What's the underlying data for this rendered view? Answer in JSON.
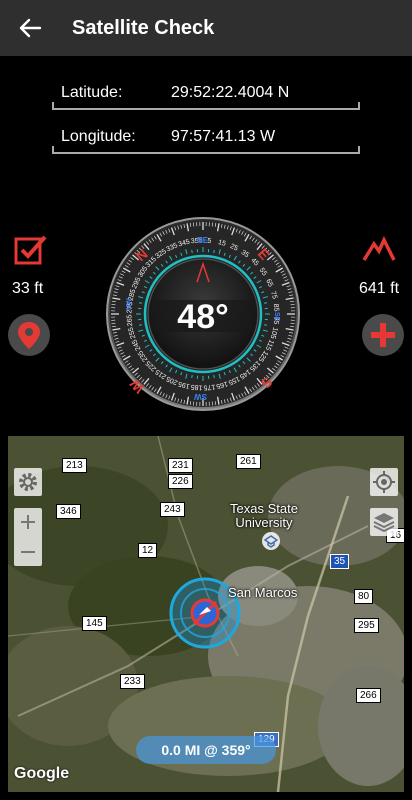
{
  "appbar": {
    "title": "Satellite Check"
  },
  "coords": {
    "latitude_label": "Latitude:",
    "latitude_value": "29:52:22.4004 N",
    "longitude_label": "Longitude:",
    "longitude_value": "97:57:41.13 W"
  },
  "left_panel": {
    "accuracy": "33 ft"
  },
  "right_panel": {
    "altitude": "641 ft"
  },
  "compass": {
    "heading": "48°",
    "cardinals": {
      "n": "N",
      "e": "E",
      "s": "S",
      "w": "W"
    },
    "inner": {
      "ne": "NE",
      "se": "SE",
      "sw": "SW",
      "nw": "NW"
    }
  },
  "map": {
    "status": "0.0 MI @ 359°",
    "provider": "Google",
    "places": {
      "university": "Texas State\nUniversity",
      "city": "San Marcos"
    },
    "shields": [
      "213",
      "231",
      "261",
      "226",
      "346",
      "243",
      "12",
      "145",
      "233",
      "35",
      "80",
      "295",
      "266",
      "16",
      "129"
    ]
  },
  "colors": {
    "accent_red": "#e53935",
    "teal": "#1ec0c4",
    "appbar": "#2f2f2f"
  }
}
